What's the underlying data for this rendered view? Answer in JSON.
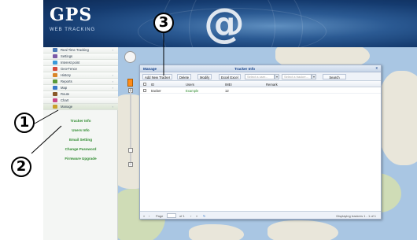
{
  "header": {
    "logo_main": "GPS",
    "logo_sub": "WEB TRACKING",
    "at_symbol": "@"
  },
  "sidebar": {
    "items": [
      {
        "label": "Real Time Tracking",
        "icon": "car-icon",
        "color": "#4a7ab8"
      },
      {
        "label": "Settings",
        "icon": "gear-icon",
        "color": "#7b5aa6"
      },
      {
        "label": "Interest point",
        "icon": "pin-icon",
        "color": "#3a9ad9"
      },
      {
        "label": "Geo-Fence",
        "icon": "fence-icon",
        "color": "#d64a3a"
      },
      {
        "label": "History",
        "icon": "history-icon",
        "color": "#d9862a"
      },
      {
        "label": "Reports",
        "icon": "report-icon",
        "color": "#5a9a3a"
      },
      {
        "label": "Map",
        "icon": "map-icon",
        "color": "#3a7ac9"
      },
      {
        "label": "Route",
        "icon": "route-icon",
        "color": "#8a5a2a"
      },
      {
        "label": "Chart",
        "icon": "chart-icon",
        "color": "#c94a8a"
      },
      {
        "label": "Manage",
        "icon": "manage-icon",
        "color": "#c9a02a"
      }
    ],
    "sub_items": [
      "Tracker Info",
      "Users Info",
      "Email Setting",
      "Change Password",
      "Firmware Upgrade"
    ]
  },
  "panel": {
    "section_title": "Manage",
    "window_title": "Tracker Info",
    "close_glyph": "x",
    "toolbar": {
      "add_button": "Add New Tracker",
      "delete_button": "Delete",
      "modify_button": "Modify",
      "export_button": "Excel Excel",
      "select_user_placeholder": "Select a user...",
      "select_tracker_placeholder": "Select a tracker...",
      "search_button": "Search"
    },
    "columns": [
      "ID",
      "Users",
      "IMEI",
      "Remark"
    ],
    "rows": [
      {
        "id": "tracker",
        "user": "Example",
        "imei": "12",
        "remark": ""
      }
    ],
    "pager": {
      "page_label": "Page",
      "of_label": "of 1",
      "display_text": "Displaying trackers 1 - 1 of 1"
    }
  },
  "callouts": [
    "1",
    "2",
    "3"
  ]
}
